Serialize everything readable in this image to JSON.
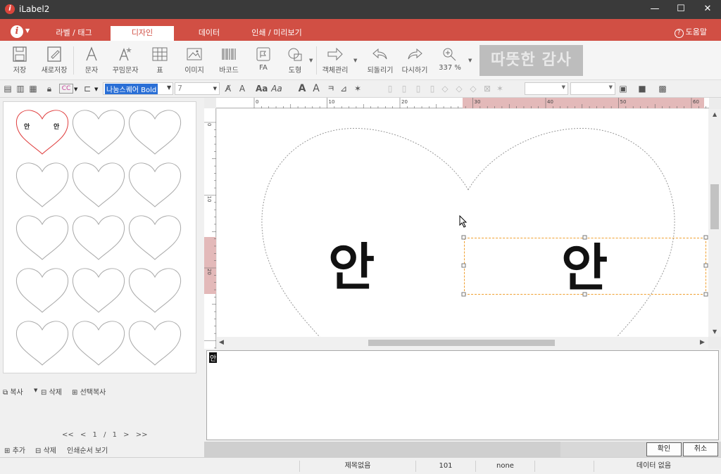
{
  "window": {
    "title": "iLabel2",
    "controls": {
      "minimize": "—",
      "maximize": "☐",
      "close": "✕"
    }
  },
  "tabs": [
    {
      "label": "라벨 / 태그",
      "active": false
    },
    {
      "label": "디자인",
      "active": true
    },
    {
      "label": "데이터",
      "active": false
    },
    {
      "label": "인쇄 / 미리보기",
      "active": false
    }
  ],
  "help_label": "도움말",
  "toolbar": {
    "save": "저장",
    "save_as": "새로저장",
    "text": "문자",
    "deco_text": "꾸밈문자",
    "table": "표",
    "image": "이미지",
    "barcode": "바코드",
    "fa": "FA",
    "shape": "도형",
    "object_mgmt": "객체관리",
    "undo": "되돌리기",
    "redo": "다시하기",
    "zoom": "337 %",
    "banner": "따뜻한 감사"
  },
  "format": {
    "font": "나눔스퀘어 Bold",
    "size": "7"
  },
  "ruler": {
    "h_marks": [
      "0",
      "10",
      "20",
      "30",
      "40",
      "50",
      "60"
    ],
    "v_marks": [
      "0",
      "10",
      "20"
    ]
  },
  "canvas": {
    "left_text": "안",
    "right_text": "안"
  },
  "thumbnail": {
    "left_text": "안",
    "right_text": "안"
  },
  "left_panel": {
    "copy": "복사",
    "delete": "삭제",
    "select_copy": "선택복사",
    "pager": {
      "first": "<<",
      "prev": "<",
      "page": "1 / 1",
      "next": ">",
      "last": ">>"
    },
    "add": "추가",
    "delete2": "삭제",
    "print_order": "인쇄순서 보기"
  },
  "editor": {
    "content": "안",
    "ok": "확인",
    "cancel": "취소"
  },
  "status": {
    "title": "제목없음",
    "code": "101",
    "mode": "none",
    "data": "데이터 없음"
  },
  "colors": {
    "accent": "#d14f44",
    "titlebar": "#3a3a3a",
    "selection": "#f0a030"
  }
}
